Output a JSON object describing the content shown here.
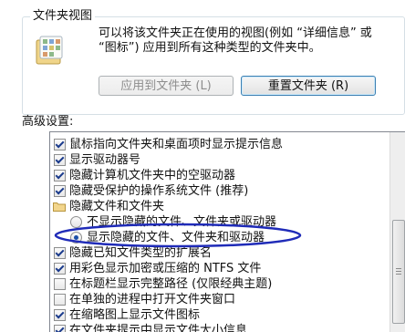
{
  "folder_views": {
    "title": "文件夹视图",
    "description": "可以将该文件夹正在使用的视图(例如 “详细信息” 或 “图标”) 应用到所有这种类型的文件夹中。",
    "apply_button": "应用到文件夹 (L)",
    "reset_button": "重置文件夹 (R)"
  },
  "advanced": {
    "label": "高级设置:",
    "items": [
      {
        "type": "checkbox",
        "checked": true,
        "label": "鼠标指向文件夹和桌面项时显示提示信息"
      },
      {
        "type": "checkbox",
        "checked": true,
        "label": "显示驱动器号"
      },
      {
        "type": "checkbox",
        "checked": true,
        "label": "隐藏计算机文件夹中的空驱动器"
      },
      {
        "type": "checkbox",
        "checked": true,
        "label": "隐藏受保护的操作系统文件 (推荐)"
      },
      {
        "type": "folder",
        "label": "隐藏文件和文件夹"
      },
      {
        "type": "radio",
        "checked": false,
        "label": "不显示隐藏的文件、文件夹或驱动器"
      },
      {
        "type": "radio",
        "checked": true,
        "label": "显示隐藏的文件、文件夹和驱动器"
      },
      {
        "type": "checkbox",
        "checked": true,
        "label": "隐藏已知文件类型的扩展名"
      },
      {
        "type": "checkbox",
        "checked": true,
        "label": "用彩色显示加密或压缩的 NTFS 文件"
      },
      {
        "type": "checkbox",
        "checked": false,
        "label": "在标题栏显示完整路径 (仅限经典主题)"
      },
      {
        "type": "checkbox",
        "checked": false,
        "label": "在单独的进程中打开文件夹窗口"
      },
      {
        "type": "checkbox",
        "checked": true,
        "label": "在缩略图上显示文件图标"
      },
      {
        "type": "checkbox",
        "checked": true,
        "label": "在文件夹提示中显示文件大小信息"
      }
    ]
  },
  "colors": {
    "annotation": "#1f2bb8",
    "accent": "#3c7fb1"
  }
}
